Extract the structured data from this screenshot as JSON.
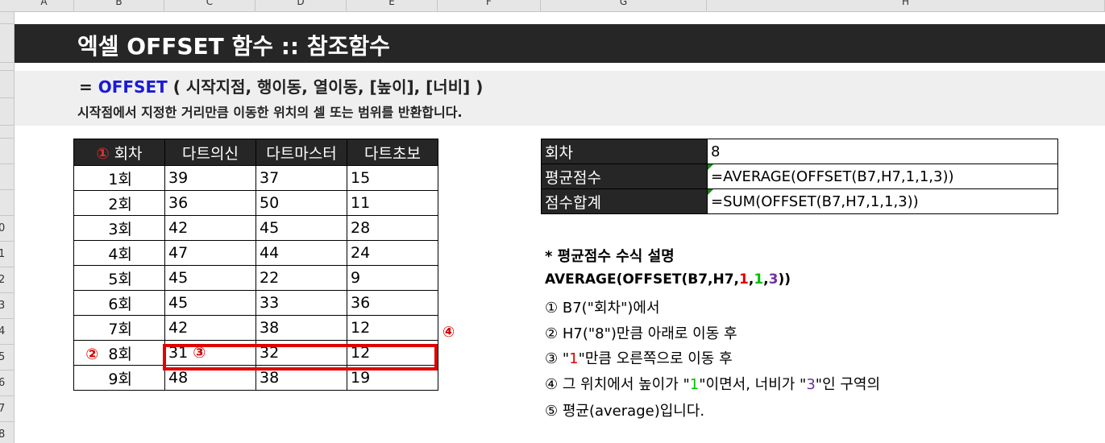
{
  "column_headers": [
    "A",
    "B",
    "C",
    "D",
    "E",
    "F",
    "G",
    "H"
  ],
  "row_headers": [
    "",
    "",
    "",
    "",
    "",
    "",
    "",
    "",
    "",
    "0",
    "1",
    "2",
    "3",
    "4",
    "5",
    "6",
    "7",
    "8"
  ],
  "title": "엑셀 OFFSET 함수 :: 참조함수",
  "syntax": {
    "prefix": "= ",
    "function": "OFFSET",
    "args": " ( 시작지점, 행이동, 열이동, [높이], [너비] )",
    "description": "시작점에서 지정한 거리만큼 이동한 위치의 셀 또는 범위를 반환합니다."
  },
  "data_table": {
    "header_marker": "①",
    "headers": [
      "회차",
      "다트의신",
      "다트마스터",
      "다트초보"
    ],
    "rows": [
      [
        "1회",
        "39",
        "37",
        "15"
      ],
      [
        "2회",
        "36",
        "50",
        "11"
      ],
      [
        "3회",
        "42",
        "45",
        "28"
      ],
      [
        "4회",
        "47",
        "44",
        "24"
      ],
      [
        "5회",
        "45",
        "22",
        "9"
      ],
      [
        "6회",
        "45",
        "33",
        "36"
      ],
      [
        "7회",
        "42",
        "38",
        "12"
      ],
      [
        "8회",
        "31",
        "32",
        "12"
      ],
      [
        "9회",
        "48",
        "38",
        "19"
      ]
    ],
    "marker_row8": "②",
    "marker_cell": "③",
    "marker_right": "④"
  },
  "formula_table": [
    {
      "label": "회차",
      "value": "8"
    },
    {
      "label": "평균점수",
      "value": "=AVERAGE(OFFSET(B7,H7,1,1,3))"
    },
    {
      "label": "점수합계",
      "value": "=SUM(OFFSET(B7,H7,1,1,3))"
    }
  ],
  "explanation": {
    "title": "* 평균점수 수식 설명",
    "formula": {
      "pre": "AVERAGE(OFFSET(B7,H7,",
      "a": "1",
      "c1": ",",
      "b": "1",
      "c2": ",",
      "c": "3",
      "post": "))"
    },
    "lines": {
      "l1": "① B7(\"회차\")에서",
      "l2": "② H7(\"8\")만큼 아래로 이동 후",
      "l3_pre": "③ \"",
      "l3_val": "1",
      "l3_post": "\"만큼 오른쪽으로 이동 후",
      "l4_pre": "④ 그 위치에서 높이가 \"",
      "l4_v1": "1",
      "l4_mid": "\"이면서, 너비가 \"",
      "l4_v2": "3",
      "l4_post": "\"인 구역의",
      "l5": "⑤ 평균(average)입니다."
    }
  },
  "colors": {
    "title_bg": "#262626",
    "function_blue": "#1a1ad6",
    "highlight_red": "#e00000",
    "green": "#00c000",
    "purple": "#7030a0"
  }
}
